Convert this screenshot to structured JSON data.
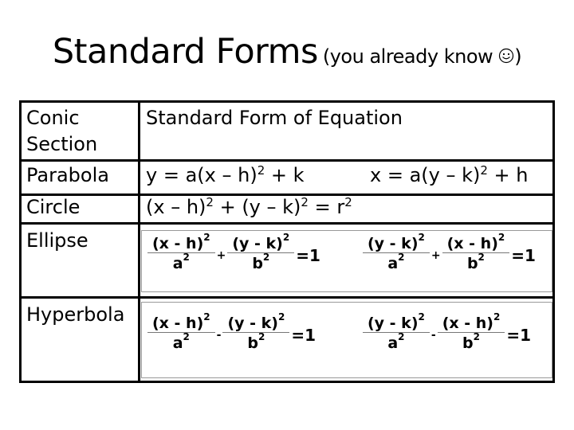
{
  "title": {
    "main": "Standard Forms",
    "sub_prefix": "(you already know",
    "sub_icon": "smiley-face-icon",
    "sub_suffix": ")"
  },
  "table": {
    "header": {
      "col1_line1": "Conic",
      "col1_line2": "Section",
      "col2": "Standard Form of Equation"
    },
    "rows": [
      {
        "conic": "Parabola",
        "equations": [
          {
            "lhs": "y = a(x – h)",
            "exp": "2",
            "rhs": " + k"
          },
          {
            "lhs": "x = a(y – k)",
            "exp": "2",
            "rhs": " + h"
          }
        ]
      },
      {
        "conic": "Circle",
        "equation": {
          "p1": "(x – h)",
          "e1": "2",
          "p2": " + (y – k)",
          "e2": "2",
          "p3": " = r",
          "e3": "2"
        }
      },
      {
        "conic": "Ellipse",
        "equations": [
          {
            "n1": "(x - h)",
            "d1": "a",
            "op": "+",
            "n2": "(y - k)",
            "d2": "b",
            "sq": "2",
            "rhs": "=1"
          },
          {
            "n1": "(y - k)",
            "d1": "a",
            "op": "+",
            "n2": "(x - h)",
            "d2": "b",
            "sq": "2",
            "rhs": "=1"
          }
        ]
      },
      {
        "conic": "Hyperbola",
        "equations": [
          {
            "n1": "(x - h)",
            "d1": "a",
            "op": "-",
            "n2": "(y - k)",
            "d2": "b",
            "sq": "2",
            "rhs": "=1"
          },
          {
            "n1": "(y - k)",
            "d1": "a",
            "op": "-",
            "n2": "(x - h)",
            "d2": "b",
            "sq": "2",
            "rhs": "=1"
          }
        ]
      }
    ]
  }
}
